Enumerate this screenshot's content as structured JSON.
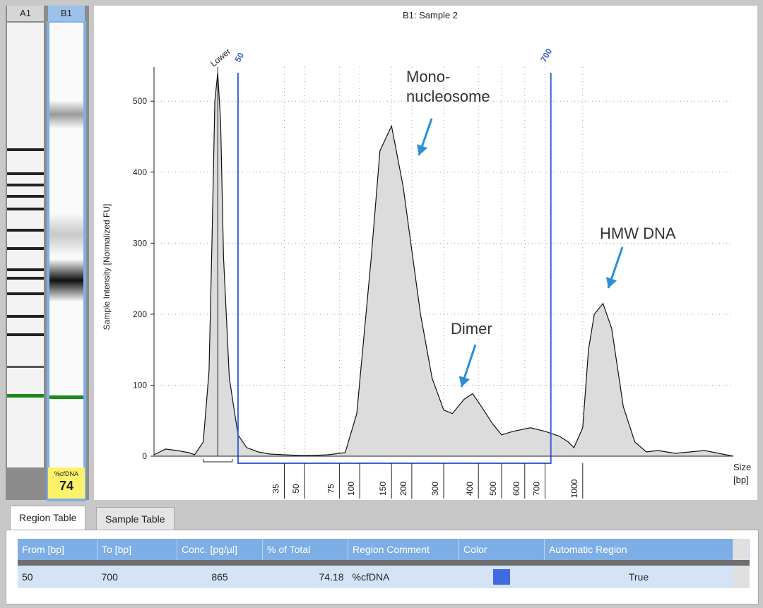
{
  "gel": {
    "lanes": [
      "A1",
      "B1"
    ],
    "badge_label": "%cfDNA",
    "badge_value": "74",
    "colors": {
      "selected": "#7fb0e6",
      "marker": "#1a8a1a",
      "badge": "#fff26b"
    }
  },
  "chart_data": {
    "type": "area",
    "title": "B1: Sample 2",
    "ylabel": "Sample Intensity [Normalized FU]",
    "xlabel": "Size\n[bp]",
    "xlabel_lines": [
      "Size",
      "[bp]"
    ],
    "ylim": [
      0,
      540
    ],
    "yticks": [
      0,
      100,
      200,
      300,
      400,
      500
    ],
    "xticks": [
      "35",
      "50",
      "75",
      "100",
      "150",
      "200",
      "300",
      "400",
      "500",
      "600",
      "700",
      "1000"
    ],
    "grid": true,
    "series": [
      {
        "x": [
          0,
          4,
          8,
          12,
          14,
          17,
          19,
          20,
          21,
          22,
          23,
          24,
          26,
          29,
          32,
          36,
          40,
          45,
          50,
          55,
          60,
          66,
          70,
          75,
          78,
          82,
          86,
          92,
          96,
          100,
          103,
          107,
          110,
          113,
          117,
          120,
          124,
          130,
          135,
          140,
          143,
          145,
          148,
          150,
          152,
          155,
          158,
          162,
          166,
          170,
          174,
          180,
          190,
          200
        ],
        "y": [
          2,
          10,
          8,
          5,
          2,
          20,
          120,
          300,
          500,
          540,
          470,
          280,
          110,
          30,
          12,
          6,
          3,
          2,
          1,
          1,
          2,
          5,
          60,
          280,
          430,
          465,
          380,
          200,
          110,
          65,
          60,
          80,
          88,
          70,
          45,
          30,
          35,
          40,
          35,
          28,
          20,
          12,
          40,
          150,
          200,
          215,
          180,
          70,
          20,
          6,
          8,
          4,
          8,
          0
        ]
      }
    ],
    "markers": [
      {
        "label": "Lower"
      },
      {
        "label": "50"
      },
      {
        "label": "700"
      }
    ],
    "annotations": [
      "Mono-\nnucleosome",
      "Dimer",
      "HMW DNA"
    ],
    "annotation_lines": [
      [
        "Mono-",
        "nucleosome"
      ],
      [
        "Dimer"
      ],
      [
        "HMW DNA"
      ]
    ]
  },
  "tabs": [
    {
      "label": "Region Table",
      "active": true
    },
    {
      "label": "Sample Table",
      "active": false
    }
  ],
  "region_table": {
    "columns": [
      "From [bp]",
      "To [bp]",
      "Conc. [pg/µl]",
      "% of Total",
      "Region Comment",
      "Color",
      "Automatic Region"
    ],
    "rows": [
      {
        "from": "50",
        "to": "700",
        "conc": "865",
        "pct": "74.18",
        "comment": "%cfDNA",
        "color": "#4169e1",
        "auto": "True"
      }
    ]
  }
}
